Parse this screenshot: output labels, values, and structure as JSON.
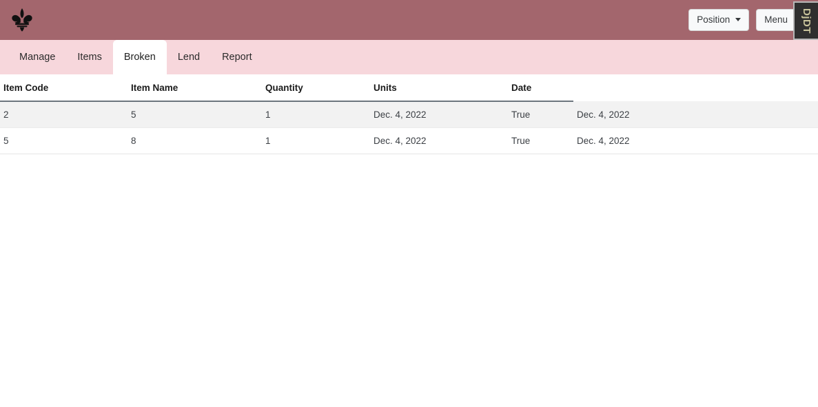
{
  "header": {
    "logo_icon": "fleur-de-lis-icon",
    "background_color": "#a3666d",
    "position_button": {
      "label": "Position",
      "caret_icon": "caret-down-icon"
    },
    "menu_button": {
      "label": "Menu",
      "caret_icon": "caret-down-icon"
    }
  },
  "debug_toolbar": {
    "handle_label": "DjDT"
  },
  "nav": {
    "background_color": "#f7d7dc",
    "active_tab": "Broken",
    "tabs": [
      {
        "label": "Manage",
        "active": false
      },
      {
        "label": "Items",
        "active": false
      },
      {
        "label": "Broken",
        "active": true
      },
      {
        "label": "Lend",
        "active": false
      },
      {
        "label": "Report",
        "active": false
      }
    ]
  },
  "table": {
    "columns": [
      "Item Code",
      "Item Name",
      "Quantity",
      "Units",
      "Date",
      ""
    ],
    "rows": [
      {
        "item_code": "2",
        "item_name": "5",
        "quantity": "1",
        "units": "Dec. 4, 2022",
        "date": "True",
        "extra": "Dec. 4, 2022"
      },
      {
        "item_code": "5",
        "item_name": "8",
        "quantity": "1",
        "units": "Dec. 4, 2022",
        "date": "True",
        "extra": "Dec. 4, 2022"
      }
    ]
  }
}
